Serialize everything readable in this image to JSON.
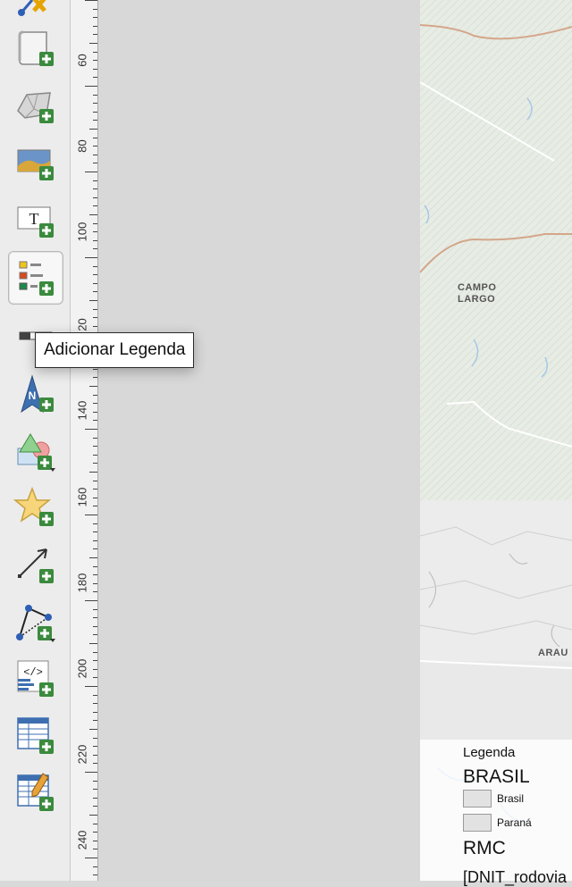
{
  "toolbar": {
    "tools": [
      {
        "name": "add-item-tool",
        "icon": "wand-icon"
      },
      {
        "name": "add-page-tool",
        "icon": "page-scroll-icon"
      },
      {
        "name": "add-map-tool",
        "icon": "map-icon"
      },
      {
        "name": "add-picture-tool",
        "icon": "picture-icon"
      },
      {
        "name": "add-label-tool",
        "icon": "text-label-icon"
      },
      {
        "name": "add-legend-tool",
        "icon": "legend-icon",
        "active": true
      },
      {
        "name": "add-scalebar-tool",
        "icon": "scalebar-icon"
      },
      {
        "name": "add-north-arrow-tool",
        "icon": "north-arrow-icon"
      },
      {
        "name": "add-shape-tool",
        "icon": "shapes-icon"
      },
      {
        "name": "add-marker-tool",
        "icon": "star-icon"
      },
      {
        "name": "add-arrow-tool",
        "icon": "arrow-icon"
      },
      {
        "name": "add-node-item-tool",
        "icon": "polyline-icon"
      },
      {
        "name": "add-html-tool",
        "icon": "html-icon"
      },
      {
        "name": "add-attribute-table-tool",
        "icon": "table-icon"
      },
      {
        "name": "add-fixed-table-tool",
        "icon": "table-edit-icon"
      }
    ],
    "accent_add": "#3b8a3e"
  },
  "tooltip": {
    "text": "Adicionar Legenda"
  },
  "ruler": {
    "labels": [
      "60",
      "80",
      "100",
      "20",
      "140",
      "160",
      "180",
      "200",
      "220",
      "240"
    ]
  },
  "map": {
    "labels": {
      "campo_largo_line1": "CAMPO",
      "campo_largo_line2": "LARGO",
      "araucaria": "ARAU"
    }
  },
  "legend": {
    "title": "Legenda",
    "group1": "BRASIL",
    "items": [
      "Brasil",
      "Paraná"
    ],
    "group2": "RMC",
    "cut_text": "[DNIT_rodovia"
  }
}
